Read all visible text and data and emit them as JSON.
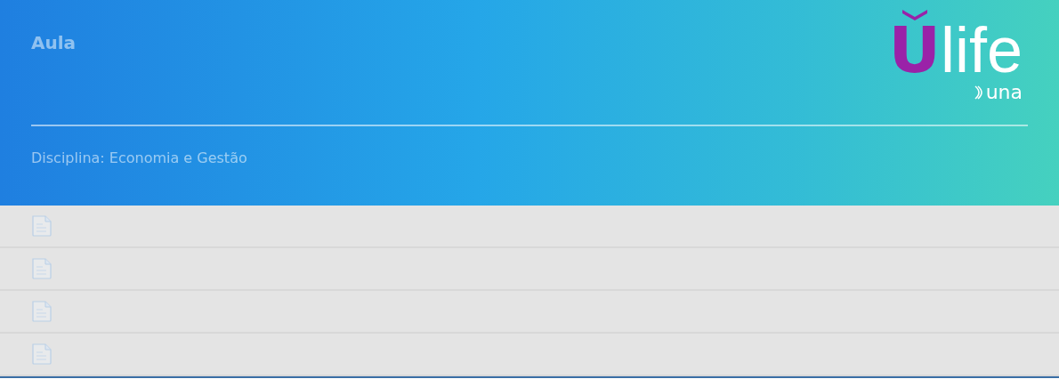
{
  "header": {
    "title": "Aula",
    "subtitle": "Disciplina: Economia e Gestão"
  },
  "logo": {
    "accent": "U",
    "rest": "life",
    "sub": "una"
  },
  "rows": [
    {
      "kind": "document"
    },
    {
      "kind": "document"
    },
    {
      "kind": "document"
    },
    {
      "kind": "document"
    }
  ]
}
